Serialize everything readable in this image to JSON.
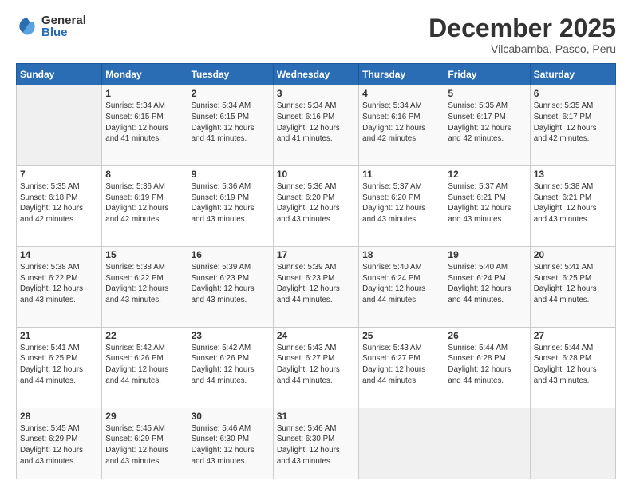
{
  "logo": {
    "general": "General",
    "blue": "Blue"
  },
  "title": "December 2025",
  "subtitle": "Vilcabamba, Pasco, Peru",
  "days_of_week": [
    "Sunday",
    "Monday",
    "Tuesday",
    "Wednesday",
    "Thursday",
    "Friday",
    "Saturday"
  ],
  "weeks": [
    [
      {
        "day": null,
        "info": null
      },
      {
        "day": "1",
        "info": "Sunrise: 5:34 AM\nSunset: 6:15 PM\nDaylight: 12 hours\nand 41 minutes."
      },
      {
        "day": "2",
        "info": "Sunrise: 5:34 AM\nSunset: 6:15 PM\nDaylight: 12 hours\nand 41 minutes."
      },
      {
        "day": "3",
        "info": "Sunrise: 5:34 AM\nSunset: 6:16 PM\nDaylight: 12 hours\nand 41 minutes."
      },
      {
        "day": "4",
        "info": "Sunrise: 5:34 AM\nSunset: 6:16 PM\nDaylight: 12 hours\nand 42 minutes."
      },
      {
        "day": "5",
        "info": "Sunrise: 5:35 AM\nSunset: 6:17 PM\nDaylight: 12 hours\nand 42 minutes."
      },
      {
        "day": "6",
        "info": "Sunrise: 5:35 AM\nSunset: 6:17 PM\nDaylight: 12 hours\nand 42 minutes."
      }
    ],
    [
      {
        "day": "7",
        "info": "Sunrise: 5:35 AM\nSunset: 6:18 PM\nDaylight: 12 hours\nand 42 minutes."
      },
      {
        "day": "8",
        "info": "Sunrise: 5:36 AM\nSunset: 6:19 PM\nDaylight: 12 hours\nand 42 minutes."
      },
      {
        "day": "9",
        "info": "Sunrise: 5:36 AM\nSunset: 6:19 PM\nDaylight: 12 hours\nand 43 minutes."
      },
      {
        "day": "10",
        "info": "Sunrise: 5:36 AM\nSunset: 6:20 PM\nDaylight: 12 hours\nand 43 minutes."
      },
      {
        "day": "11",
        "info": "Sunrise: 5:37 AM\nSunset: 6:20 PM\nDaylight: 12 hours\nand 43 minutes."
      },
      {
        "day": "12",
        "info": "Sunrise: 5:37 AM\nSunset: 6:21 PM\nDaylight: 12 hours\nand 43 minutes."
      },
      {
        "day": "13",
        "info": "Sunrise: 5:38 AM\nSunset: 6:21 PM\nDaylight: 12 hours\nand 43 minutes."
      }
    ],
    [
      {
        "day": "14",
        "info": "Sunrise: 5:38 AM\nSunset: 6:22 PM\nDaylight: 12 hours\nand 43 minutes."
      },
      {
        "day": "15",
        "info": "Sunrise: 5:38 AM\nSunset: 6:22 PM\nDaylight: 12 hours\nand 43 minutes."
      },
      {
        "day": "16",
        "info": "Sunrise: 5:39 AM\nSunset: 6:23 PM\nDaylight: 12 hours\nand 43 minutes."
      },
      {
        "day": "17",
        "info": "Sunrise: 5:39 AM\nSunset: 6:23 PM\nDaylight: 12 hours\nand 44 minutes."
      },
      {
        "day": "18",
        "info": "Sunrise: 5:40 AM\nSunset: 6:24 PM\nDaylight: 12 hours\nand 44 minutes."
      },
      {
        "day": "19",
        "info": "Sunrise: 5:40 AM\nSunset: 6:24 PM\nDaylight: 12 hours\nand 44 minutes."
      },
      {
        "day": "20",
        "info": "Sunrise: 5:41 AM\nSunset: 6:25 PM\nDaylight: 12 hours\nand 44 minutes."
      }
    ],
    [
      {
        "day": "21",
        "info": "Sunrise: 5:41 AM\nSunset: 6:25 PM\nDaylight: 12 hours\nand 44 minutes."
      },
      {
        "day": "22",
        "info": "Sunrise: 5:42 AM\nSunset: 6:26 PM\nDaylight: 12 hours\nand 44 minutes."
      },
      {
        "day": "23",
        "info": "Sunrise: 5:42 AM\nSunset: 6:26 PM\nDaylight: 12 hours\nand 44 minutes."
      },
      {
        "day": "24",
        "info": "Sunrise: 5:43 AM\nSunset: 6:27 PM\nDaylight: 12 hours\nand 44 minutes."
      },
      {
        "day": "25",
        "info": "Sunrise: 5:43 AM\nSunset: 6:27 PM\nDaylight: 12 hours\nand 44 minutes."
      },
      {
        "day": "26",
        "info": "Sunrise: 5:44 AM\nSunset: 6:28 PM\nDaylight: 12 hours\nand 44 minutes."
      },
      {
        "day": "27",
        "info": "Sunrise: 5:44 AM\nSunset: 6:28 PM\nDaylight: 12 hours\nand 43 minutes."
      }
    ],
    [
      {
        "day": "28",
        "info": "Sunrise: 5:45 AM\nSunset: 6:29 PM\nDaylight: 12 hours\nand 43 minutes."
      },
      {
        "day": "29",
        "info": "Sunrise: 5:45 AM\nSunset: 6:29 PM\nDaylight: 12 hours\nand 43 minutes."
      },
      {
        "day": "30",
        "info": "Sunrise: 5:46 AM\nSunset: 6:30 PM\nDaylight: 12 hours\nand 43 minutes."
      },
      {
        "day": "31",
        "info": "Sunrise: 5:46 AM\nSunset: 6:30 PM\nDaylight: 12 hours\nand 43 minutes."
      },
      {
        "day": null,
        "info": null
      },
      {
        "day": null,
        "info": null
      },
      {
        "day": null,
        "info": null
      }
    ]
  ]
}
